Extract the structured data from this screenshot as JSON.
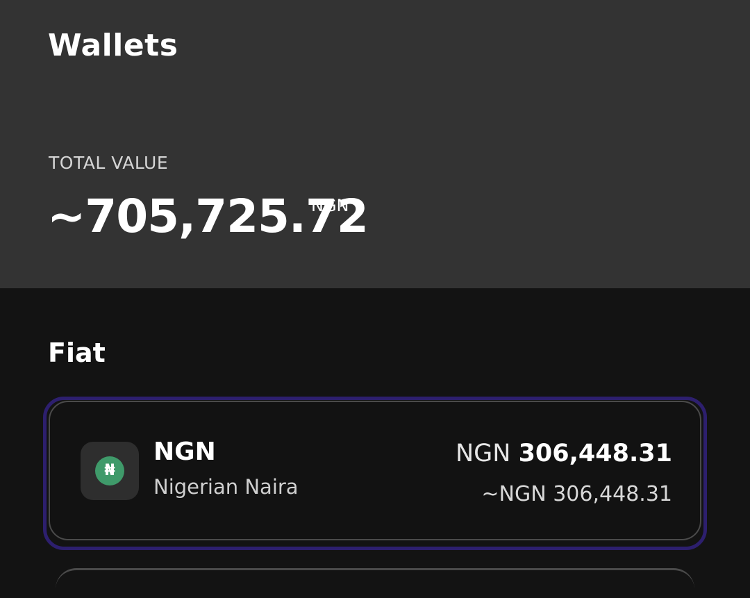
{
  "header": {
    "title": "Wallets"
  },
  "summary": {
    "label": "TOTAL VALUE",
    "amount": "~705,725.72",
    "currency": "NGN"
  },
  "sections": {
    "fiat_title": "Fiat"
  },
  "wallets": [
    {
      "symbol_glyph": "₦",
      "code": "NGN",
      "name": "Nigerian Naira",
      "balance_currency": "NGN",
      "balance_value": "306,448.31",
      "approx_value": "~NGN 306,448.31",
      "icon": "naira-coin-icon",
      "icon_color": "#3f9a6a"
    }
  ],
  "colors": {
    "header_bg": "#333333",
    "page_bg": "#131313",
    "selected_outline": "#2d1f6e"
  }
}
